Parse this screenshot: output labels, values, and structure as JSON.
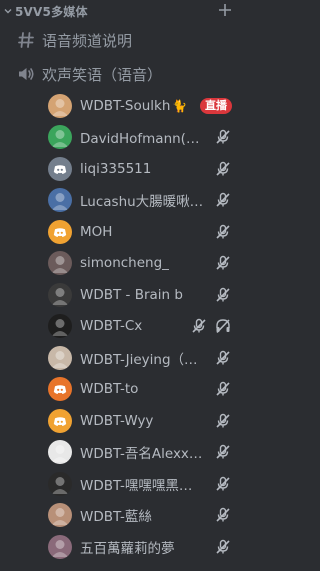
{
  "category": {
    "name": "5VV5多媒体"
  },
  "text_channel": {
    "name": "语音频道说明",
    "icon": "hashtag-icon"
  },
  "voice_channel": {
    "name": "欢声笑语（语音）",
    "icon": "speaker-icon"
  },
  "live_label": "直播",
  "users": [
    {
      "name": "WDBT-Soulkh",
      "suffix": "🐈",
      "avatar_color": "#d4a373",
      "live": true,
      "muted": false,
      "deafened": false
    },
    {
      "name": "DavidHofmann(喜…",
      "avatar_color": "#3ba55c",
      "live": false,
      "muted": true,
      "deafened": false
    },
    {
      "name": "liqi335511",
      "avatar_color": "#747f8d",
      "live": false,
      "muted": true,
      "deafened": false
    },
    {
      "name": "Lucashu大腸暖啾…",
      "avatar_color": "#4a6fa5",
      "live": false,
      "muted": true,
      "deafened": false
    },
    {
      "name": "MOH",
      "avatar_color": "#f0a232",
      "live": false,
      "muted": true,
      "deafened": false
    },
    {
      "name": "simoncheng_",
      "avatar_color": "#6b5b5b",
      "live": false,
      "muted": true,
      "deafened": false
    },
    {
      "name": "WDBT - Brain b",
      "avatar_color": "#3a3a3a",
      "live": false,
      "muted": true,
      "deafened": false
    },
    {
      "name": "WDBT-Cx",
      "avatar_color": "#1e1e1e",
      "live": false,
      "muted": true,
      "deafened": true
    },
    {
      "name": "WDBT-Jieying（一…",
      "avatar_color": "#c8b8a8",
      "live": false,
      "muted": true,
      "deafened": false
    },
    {
      "name": "WDBT-to",
      "avatar_color": "#e8742a",
      "live": false,
      "muted": true,
      "deafened": false
    },
    {
      "name": "WDBT-Wyy",
      "avatar_color": "#f0a232",
      "live": false,
      "muted": true,
      "deafened": false
    },
    {
      "name": "WDBT-吾名Alexx鑽…",
      "avatar_color": "#e8e8e8",
      "live": false,
      "muted": true,
      "deafened": false
    },
    {
      "name": "WDBT-嘿嘿嘿黑人-…",
      "avatar_color": "#2a2a2a",
      "live": false,
      "muted": true,
      "deafened": false
    },
    {
      "name": "WDBT-藍絲",
      "avatar_color": "#b89078",
      "live": false,
      "muted": true,
      "deafened": false
    },
    {
      "name": "五百萬蘿莉的夢",
      "avatar_color": "#8a6a7a",
      "live": false,
      "muted": true,
      "deafened": false
    }
  ]
}
